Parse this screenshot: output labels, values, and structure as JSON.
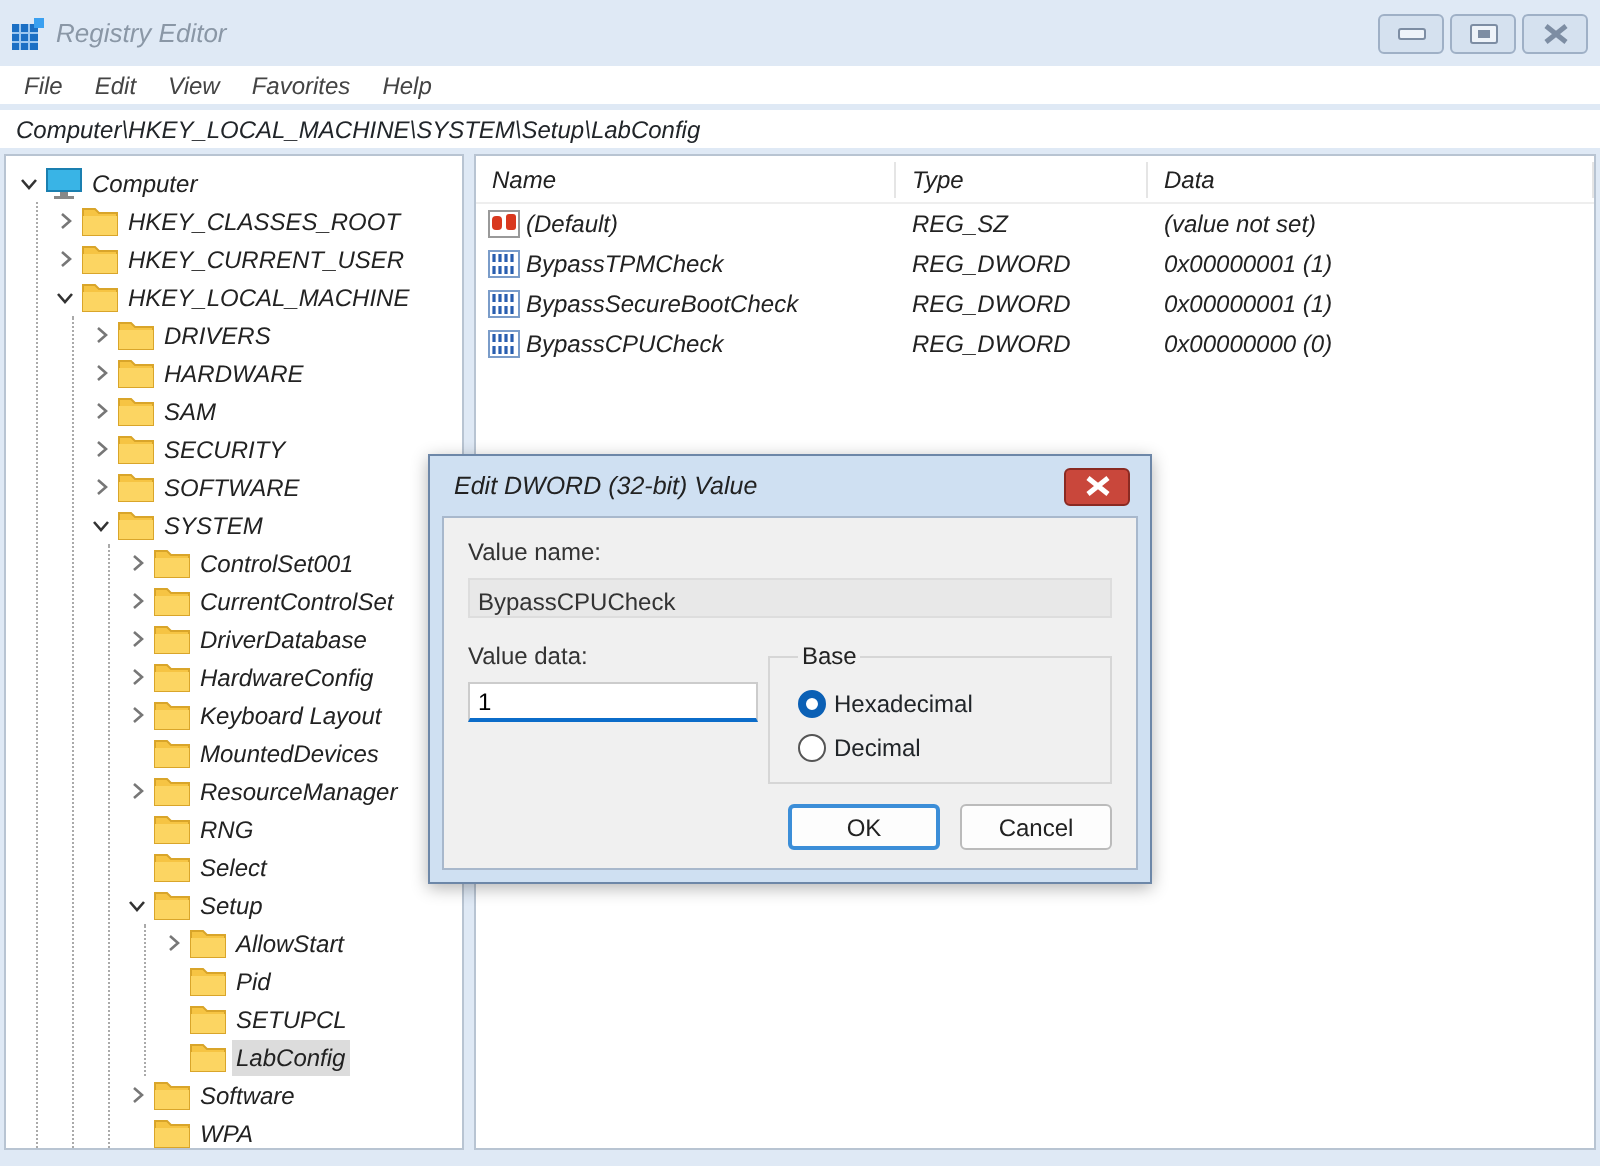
{
  "window": {
    "title": "Registry Editor"
  },
  "menu": [
    "File",
    "Edit",
    "View",
    "Favorites",
    "Help"
  ],
  "address": "Computer\\HKEY_LOCAL_MACHINE\\SYSTEM\\Setup\\LabConfig",
  "tree": [
    {
      "label": "Computer",
      "kind": "computer",
      "expanded": true,
      "selected": false,
      "children": [
        {
          "label": "HKEY_CLASSES_ROOT",
          "kind": "expandable",
          "expanded": false,
          "selected": false
        },
        {
          "label": "HKEY_CURRENT_USER",
          "kind": "expandable",
          "expanded": false,
          "selected": false
        },
        {
          "label": "HKEY_LOCAL_MACHINE",
          "kind": "expandable",
          "expanded": true,
          "selected": false,
          "children": [
            {
              "label": "DRIVERS",
              "kind": "expandable",
              "expanded": false,
              "selected": false
            },
            {
              "label": "HARDWARE",
              "kind": "expandable",
              "expanded": false,
              "selected": false
            },
            {
              "label": "SAM",
              "kind": "expandable",
              "expanded": false,
              "selected": false
            },
            {
              "label": "SECURITY",
              "kind": "expandable",
              "expanded": false,
              "selected": false
            },
            {
              "label": "SOFTWARE",
              "kind": "expandable",
              "expanded": false,
              "selected": false
            },
            {
              "label": "SYSTEM",
              "kind": "expandable",
              "expanded": true,
              "selected": false,
              "children": [
                {
                  "label": "ControlSet001",
                  "kind": "expandable",
                  "expanded": false,
                  "selected": false
                },
                {
                  "label": "CurrentControlSet",
                  "kind": "expandable",
                  "expanded": false,
                  "selected": false
                },
                {
                  "label": "DriverDatabase",
                  "kind": "expandable",
                  "expanded": false,
                  "selected": false
                },
                {
                  "label": "HardwareConfig",
                  "kind": "expandable",
                  "expanded": false,
                  "selected": false
                },
                {
                  "label": "Keyboard Layout",
                  "kind": "expandable",
                  "expanded": false,
                  "selected": false
                },
                {
                  "label": "MountedDevices",
                  "kind": "leaf",
                  "selected": false
                },
                {
                  "label": "ResourceManager",
                  "kind": "expandable",
                  "expanded": false,
                  "selected": false
                },
                {
                  "label": "RNG",
                  "kind": "leaf",
                  "selected": false
                },
                {
                  "label": "Select",
                  "kind": "leaf",
                  "selected": false
                },
                {
                  "label": "Setup",
                  "kind": "expandable",
                  "expanded": true,
                  "selected": false,
                  "children": [
                    {
                      "label": "AllowStart",
                      "kind": "expandable",
                      "expanded": false,
                      "selected": false
                    },
                    {
                      "label": "Pid",
                      "kind": "leaf",
                      "selected": false
                    },
                    {
                      "label": "SETUPCL",
                      "kind": "leaf",
                      "selected": false
                    },
                    {
                      "label": "LabConfig",
                      "kind": "leaf",
                      "selected": true
                    }
                  ]
                },
                {
                  "label": "Software",
                  "kind": "expandable",
                  "expanded": false,
                  "selected": false
                },
                {
                  "label": "WPA",
                  "kind": "leaf",
                  "selected": false
                }
              ]
            }
          ]
        }
      ]
    }
  ],
  "values": {
    "columns": [
      "Name",
      "Type",
      "Data"
    ],
    "rows": [
      {
        "kind": "string",
        "name": "(Default)",
        "type": "REG_SZ",
        "data": "(value not set)"
      },
      {
        "kind": "dword",
        "name": "BypassTPMCheck",
        "type": "REG_DWORD",
        "data": "0x00000001 (1)"
      },
      {
        "kind": "dword",
        "name": "BypassSecureBootCheck",
        "type": "REG_DWORD",
        "data": "0x00000001 (1)"
      },
      {
        "kind": "dword",
        "name": "BypassCPUCheck",
        "type": "REG_DWORD",
        "data": "0x00000000 (0)"
      }
    ]
  },
  "dialog": {
    "title": "Edit DWORD (32-bit) Value",
    "value_name_label": "Value name:",
    "value_name": "BypassCPUCheck",
    "value_data_label": "Value data:",
    "value_data": "1",
    "base": {
      "label": "Base",
      "options": [
        {
          "label": "Hexadecimal",
          "selected": true
        },
        {
          "label": "Decimal",
          "selected": false
        }
      ]
    },
    "buttons": [
      {
        "label": "OK",
        "default": true
      },
      {
        "label": "Cancel",
        "default": false
      }
    ]
  }
}
